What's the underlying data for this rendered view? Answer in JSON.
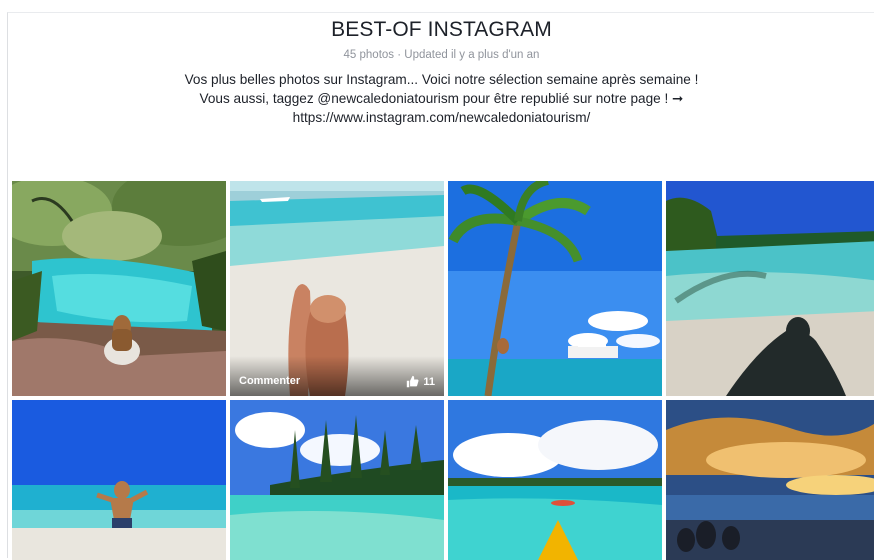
{
  "album": {
    "title": "BEST-OF INSTAGRAM",
    "meta": "45 photos · Updated il y a plus d'un an",
    "description_lines": [
      "Vos plus belles photos sur Instagram... Voici notre sélection semaine après semaine !",
      "Vous aussi, taggez @newcaledoniatourism pour être republié sur notre page ! ➞",
      "https://www.instagram.com/newcaledoniatourism/"
    ]
  },
  "hover": {
    "comment_label": "Commenter",
    "like_count": "11"
  },
  "photos": [
    {
      "subject": "woman-at-lagoon-pool"
    },
    {
      "subject": "legs-on-beach"
    },
    {
      "subject": "palm-tree-and-cruise-ship"
    },
    {
      "subject": "shadow-on-lagoon"
    },
    {
      "subject": "man-jumping-beach"
    },
    {
      "subject": "pine-island-lagoon"
    },
    {
      "subject": "kayak-in-lagoon"
    },
    {
      "subject": "sunset-people-silhouette"
    }
  ]
}
